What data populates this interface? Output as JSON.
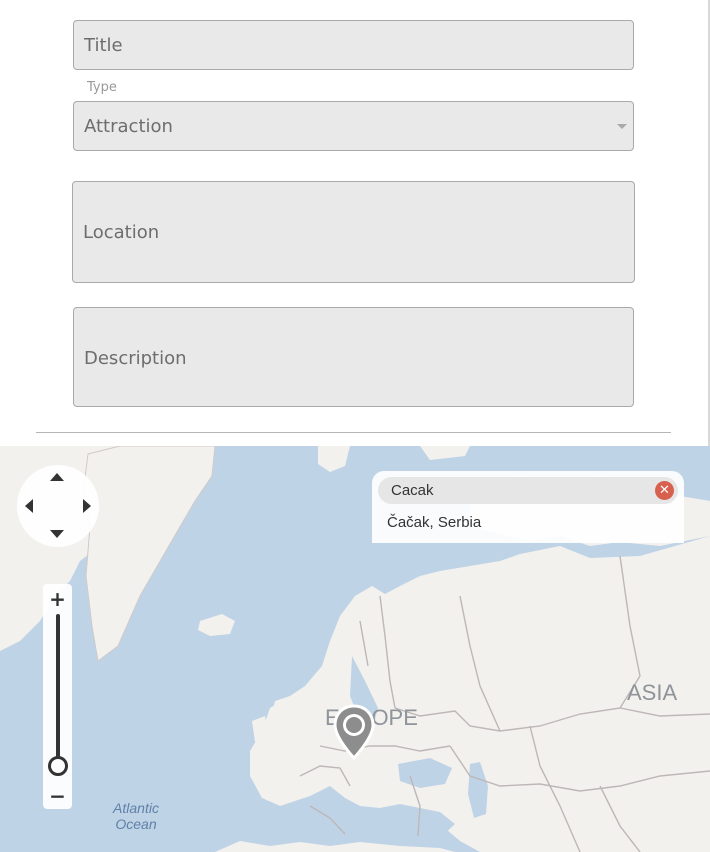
{
  "form": {
    "title_placeholder": "Title",
    "type_label": "Type",
    "type_value": "Attraction",
    "location_placeholder": "Location",
    "description_placeholder": "Description"
  },
  "map": {
    "search_query": "Cacak",
    "clear_icon": "close-icon",
    "suggestion": "Čačak, Serbia",
    "labels": {
      "europe": "EUROPE",
      "asia": "ASIA",
      "ocean": "Atlantic\nOcean"
    },
    "zoom": {
      "plus": "+",
      "minus": "−"
    },
    "colors": {
      "water": "#bfd3e6",
      "land": "#f3f1ee",
      "border": "#bdb7b7",
      "clear": "#d8604e"
    }
  }
}
